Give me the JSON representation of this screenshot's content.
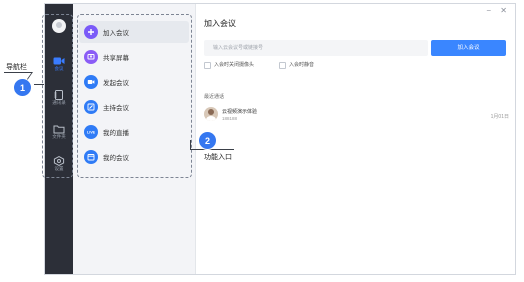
{
  "window": {
    "minimize_glyph": "−",
    "close_glyph": "✕"
  },
  "nav": {
    "items": [
      {
        "label": "会议",
        "icon": "video-camera-icon",
        "active": true
      },
      {
        "label": "通讯录",
        "icon": "contacts-icon",
        "active": false
      },
      {
        "label": "文件夹",
        "icon": "folder-icon",
        "active": false
      },
      {
        "label": "设置",
        "icon": "gear-icon",
        "active": false
      }
    ]
  },
  "menu": {
    "items": [
      {
        "label": "加入会议",
        "icon": "plus-icon",
        "color": "#7a5af8",
        "active": true
      },
      {
        "label": "共享屏幕",
        "icon": "share-screen-icon",
        "color": "#8a5cf6",
        "active": false
      },
      {
        "label": "发起会议",
        "icon": "video-icon",
        "color": "#2f7bf6",
        "active": false
      },
      {
        "label": "主持会议",
        "icon": "edit-icon",
        "color": "#2f7bf6",
        "active": false
      },
      {
        "label": "我的直播",
        "icon": "live-icon",
        "color": "#2f7bf6",
        "active": false
      },
      {
        "label": "我的会议",
        "icon": "calendar-icon",
        "color": "#2f7bf6",
        "active": false
      }
    ]
  },
  "join": {
    "title": "加入会议",
    "input_placeholder": "输入云会议号或链接号",
    "button_label": "加入会议",
    "options": [
      {
        "label": "入会时关闭摄像头",
        "checked": false
      },
      {
        "label": "入会时静音",
        "checked": false
      }
    ]
  },
  "recent": {
    "section_title": "最近通话",
    "items": [
      {
        "name": "云视频演示体验",
        "id": "188188",
        "date": "1月01日"
      }
    ]
  },
  "annotations": {
    "nav_label": "导航栏",
    "nav_badge": "1",
    "func_label": "功能入口",
    "func_badge": "2"
  },
  "colors": {
    "nav_bg": "#2c2f38",
    "accent": "#3a86ff",
    "badge": "#3577f0"
  }
}
